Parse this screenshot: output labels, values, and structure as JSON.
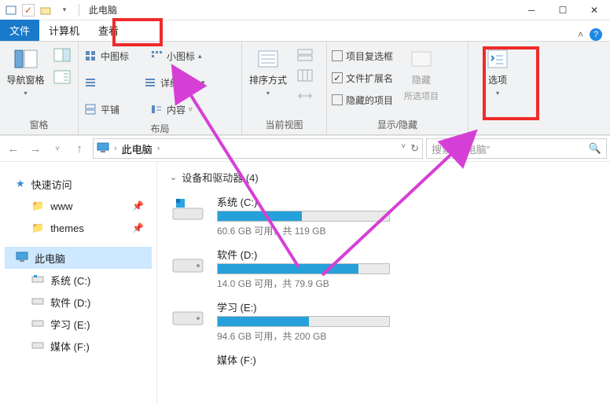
{
  "titlebar": {
    "title": "此电脑"
  },
  "tabs": {
    "file": "文件",
    "computer": "计算机",
    "view": "查看"
  },
  "ribbon": {
    "panes": {
      "label": "窗格",
      "navigation": "导航窗格"
    },
    "layout": {
      "label": "布局",
      "medium_icons": "中图标",
      "small_icons": "小图标",
      "details": "详细信息",
      "tiles": "平铺",
      "content": "内容"
    },
    "currentview": {
      "label": "当前视图",
      "sort": "排序方式"
    },
    "showhide": {
      "label": "显示/隐藏",
      "item_checkboxes": "项目复选框",
      "filename_ext": "文件扩展名",
      "hidden_items": "隐藏的项目",
      "hide": "隐藏",
      "selected": "所选项目"
    },
    "options": "选项"
  },
  "address": {
    "location": "此电脑",
    "search_placeholder": "搜索\"此电脑\""
  },
  "nav": {
    "quick": "快速访问",
    "www": "www",
    "themes": "themes",
    "this_pc": "此电脑",
    "sys": "系统 (C:)",
    "soft": "软件 (D:)",
    "study": "学习 (E:)",
    "media": "媒体 (F:)"
  },
  "content": {
    "section": "设备和驱动器 (4)",
    "drives": [
      {
        "name": "系统 (C:)",
        "stat": "60.6 GB 可用，共 119 GB",
        "fill": 49
      },
      {
        "name": "软件 (D:)",
        "stat": "14.0 GB 可用，共 79.9 GB",
        "fill": 82
      },
      {
        "name": "学习 (E:)",
        "stat": "94.6 GB 可用，共 200 GB",
        "fill": 53
      },
      {
        "name": "媒体 (F:)",
        "stat": "",
        "fill": 0
      }
    ]
  }
}
